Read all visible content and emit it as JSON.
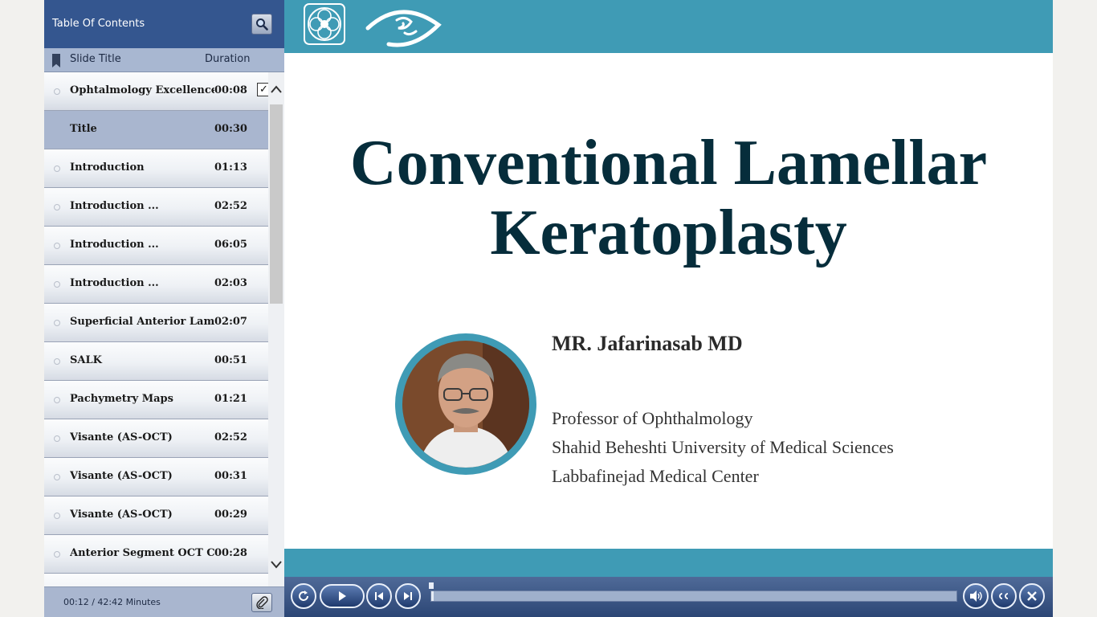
{
  "toc": {
    "title": "Table Of Contents",
    "columns": {
      "slide_title": "Slide Title",
      "duration": "Duration"
    },
    "slides": [
      {
        "title": "Ophtalmology Excellence",
        "duration": "00:08",
        "checked": true
      },
      {
        "title": "Title",
        "duration": "00:30",
        "selected": true
      },
      {
        "title": "Introduction",
        "duration": "01:13"
      },
      {
        "title": "Introduction ...",
        "duration": "02:52"
      },
      {
        "title": "Introduction ...",
        "duration": "06:05"
      },
      {
        "title": "Introduction ...",
        "duration": "02:03"
      },
      {
        "title": "Superficial Anterior Lamel...",
        "duration": "02:07"
      },
      {
        "title": "SALK",
        "duration": "00:51"
      },
      {
        "title": "Pachymetry Maps",
        "duration": "01:21"
      },
      {
        "title": "Visante (AS-OCT)",
        "duration": "02:52"
      },
      {
        "title": "Visante (AS-OCT)",
        "duration": "00:31"
      },
      {
        "title": "Visante (AS-OCT)",
        "duration": "00:29"
      },
      {
        "title": "Anterior Segment OCT Ca...",
        "duration": "00:28"
      }
    ],
    "time_status": "00:12 / 42:42 Minutes"
  },
  "slide": {
    "title_line1": "Conventional Lamellar",
    "title_line2": "Keratoplasty",
    "presenter_name": "MR. Jafarinasab MD",
    "affiliations": [
      "Professor of Ophthalmology",
      "Shahid Beheshti University of Medical Sciences",
      "Labbafinejad Medical Center"
    ]
  },
  "player": {
    "progress": 0.005
  },
  "colors": {
    "toc_header": "#34568f",
    "teal_band": "#3f9bb5",
    "title_text": "#062d3b",
    "player_bar": "#2c4675"
  }
}
